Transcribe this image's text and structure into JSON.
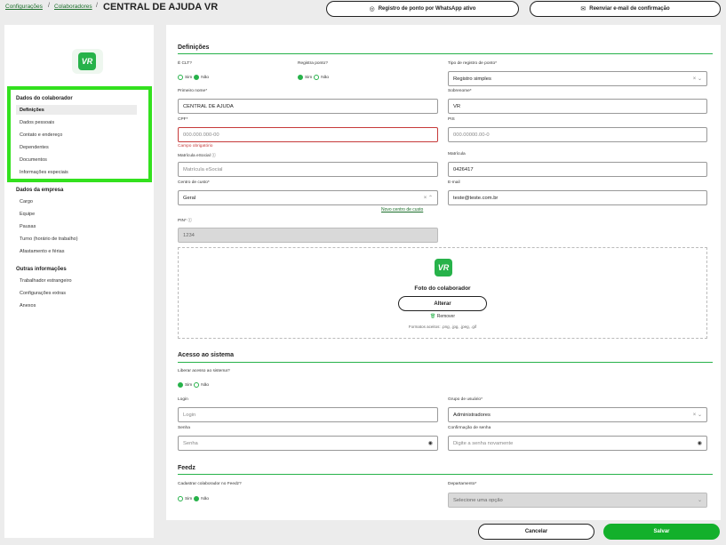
{
  "breadcrumb": {
    "item1": "Configurações",
    "sep": "/",
    "item2": "Colaboradores",
    "current": "CENTRAL DE AJUDA VR"
  },
  "top_buttons": {
    "whatsapp": "Registro de ponto por WhatsApp ativo",
    "email": "Reenviar e-mail de confirmação"
  },
  "logo_text": "VR",
  "sidebar": {
    "group1": "Dados do colaborador",
    "g1_items": [
      "Definições",
      "Dados pessoais",
      "Contato e endereço",
      "Dependentes",
      "Documentos",
      "Informações especiais"
    ],
    "group2": "Dados da empresa",
    "g2_items": [
      "Cargo",
      "Equipe",
      "Pausas",
      "Turno (horário de trabalho)",
      "Afastamento e férias"
    ],
    "group3": "Outras informações",
    "g3_items": [
      "Trabalhador estrangeiro",
      "Configurações extras",
      "Anexos"
    ]
  },
  "definicoes": {
    "title": "Definições",
    "clt_label": "É CLT?",
    "registra_label": "Registra ponto?",
    "sim": "Sim",
    "nao": "Não",
    "tipo_label": "Tipo de registro de ponto*",
    "tipo_value": "Registro simples",
    "primeiro_label": "Primeiro nome*",
    "primeiro_value": "CENTRAL DE AJUDA",
    "sobrenome_label": "Sobrenome*",
    "sobrenome_value": "VR",
    "cpf_label": "CPF*",
    "cpf_placeholder": "000.000.000-00",
    "cpf_error": "Campo obrigatório",
    "pis_label": "PIS",
    "pis_placeholder": "000.00000.00-0",
    "matesocial_label": "Matrícula eSocial",
    "matesocial_placeholder": "Matrícula eSocial",
    "matricula_label": "Matrícula",
    "matricula_value": "0426417",
    "centro_label": "Centro de custo*",
    "centro_value": "Geral",
    "novo_centro": "Novo centro de custo",
    "email_label": "E-mail",
    "email_value": "teste@teste.com.br",
    "pin_label": "PIN*",
    "pin_value": "1234",
    "foto_title": "Foto do colaborador",
    "alterar": "Alterar",
    "remover": "Remover",
    "formatos": "Formatos aceitos: .png, .jpg, .jpeg, .gif"
  },
  "acesso": {
    "title": "Acesso ao sistema",
    "liberar_label": "Liberar acesso ao sistema?",
    "login_label": "Login",
    "login_placeholder": "Login",
    "grupo_label": "Grupo de usuário*",
    "grupo_value": "Administradores",
    "senha_label": "Senha",
    "senha_placeholder": "Senha",
    "conf_label": "Confirmação de senha",
    "conf_placeholder": "Digite a senha novamente"
  },
  "feedz": {
    "title": "Feedz",
    "cadastrar_label": "Cadastrar colaborador no Feedz?",
    "depto_label": "Departamento*",
    "depto_placeholder": "Selecione uma opção"
  },
  "footer": {
    "cancelar": "Cancelar",
    "salvar": "Salvar"
  },
  "colors": {
    "accent": "#27b24a",
    "highlight": "#33e11e",
    "error": "#c63a3a"
  }
}
